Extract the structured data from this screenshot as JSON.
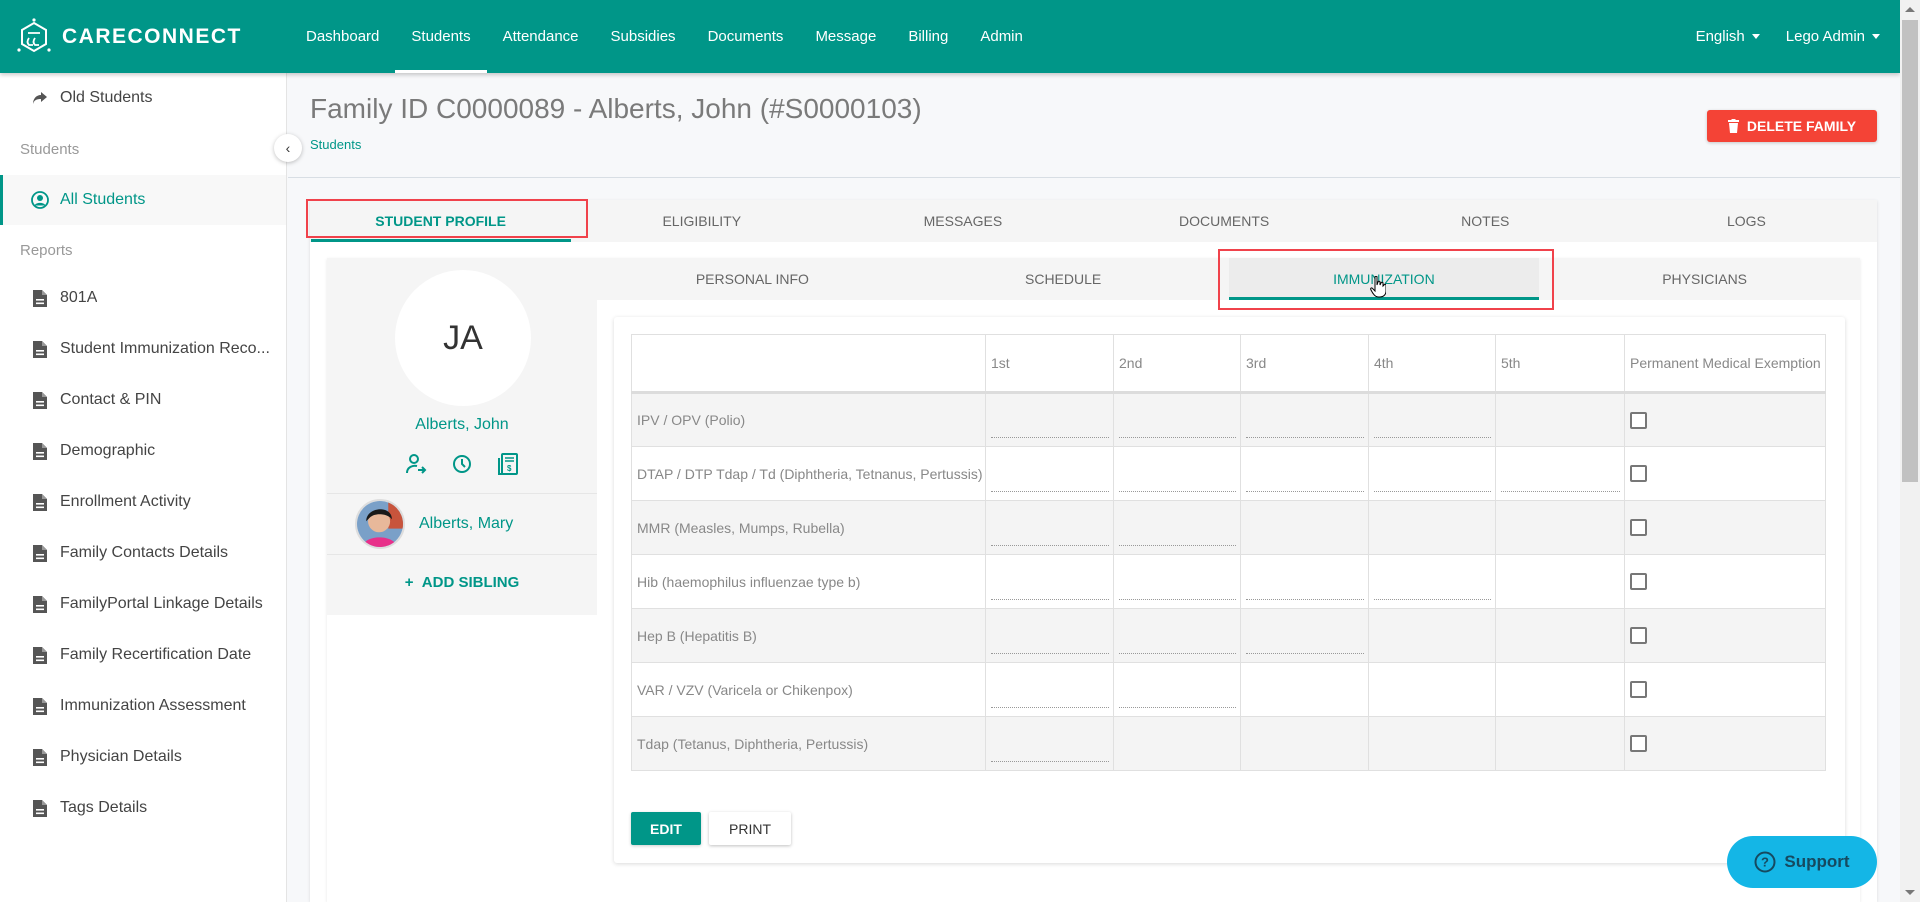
{
  "app": {
    "brand": "CARECONNECT",
    "nav": [
      "Dashboard",
      "Students",
      "Attendance",
      "Subsidies",
      "Documents",
      "Message",
      "Billing",
      "Admin"
    ],
    "nav_active": "Students",
    "language": "English",
    "user": "Lego Admin"
  },
  "sidebar": {
    "top_item": {
      "label": "Old Students",
      "icon": "share-arrow-icon"
    },
    "section_students": "Students",
    "active_item": {
      "label": "All Students",
      "icon": "user-circle-icon"
    },
    "section_reports": "Reports",
    "reports": [
      "801A",
      "Student Immunization Reco...",
      "Contact & PIN",
      "Demographic",
      "Enrollment Activity",
      "Family Contacts Details",
      "FamilyPortal Linkage Details",
      "Family Recertification Date",
      "Immunization Assessment",
      "Physician Details",
      "Tags Details"
    ]
  },
  "page": {
    "title": "Family ID C0000089 - Alberts, John (#S0000103)",
    "breadcrumb": "Students",
    "delete_button": "DELETE FAMILY"
  },
  "main_tabs": [
    "STUDENT PROFILE",
    "ELIGIBILITY",
    "MESSAGES",
    "DOCUMENTS",
    "NOTES",
    "LOGS"
  ],
  "main_tab_active": "STUDENT PROFILE",
  "profile": {
    "initials": "JA",
    "name": "Alberts, John",
    "action_icons": [
      "transfer-user-icon",
      "clock-icon",
      "billing-statement-icon"
    ],
    "sibling": {
      "name": "Alberts, Mary"
    },
    "add_sibling": "ADD SIBLING"
  },
  "sub_tabs": [
    "PERSONAL INFO",
    "SCHEDULE",
    "IMMUNIZATION",
    "PHYSICIANS"
  ],
  "sub_tab_active": "IMMUNIZATION",
  "immunization": {
    "headers": [
      "",
      "1st",
      "2nd",
      "3rd",
      "4th",
      "5th",
      "Permanent Medical Exemption"
    ],
    "rows": [
      {
        "vaccine": "IPV / OPV (Polio)",
        "doses": [
          true,
          true,
          true,
          true,
          false
        ],
        "exempt": false
      },
      {
        "vaccine": "DTAP / DTP Tdap / Td (Diphtheria, Tetnanus, Pertussis)",
        "doses": [
          true,
          true,
          true,
          true,
          true
        ],
        "exempt": false
      },
      {
        "vaccine": "MMR (Measles, Mumps, Rubella)",
        "doses": [
          true,
          true,
          false,
          false,
          false
        ],
        "exempt": false
      },
      {
        "vaccine": "Hib (haemophilus influenzae type b)",
        "doses": [
          true,
          true,
          true,
          true,
          false
        ],
        "exempt": false
      },
      {
        "vaccine": "Hep B (Hepatitis B)",
        "doses": [
          true,
          true,
          true,
          false,
          false
        ],
        "exempt": false
      },
      {
        "vaccine": "VAR / VZV (Varicela or Chikenpox)",
        "doses": [
          true,
          true,
          false,
          false,
          false
        ],
        "exempt": false
      },
      {
        "vaccine": "Tdap (Tetanus, Diphtheria, Pertussis)",
        "doses": [
          true,
          false,
          false,
          false,
          false
        ],
        "exempt": false
      }
    ],
    "edit_button": "EDIT",
    "print_button": "PRINT"
  },
  "support": {
    "label": "Support"
  },
  "colors": {
    "brand": "#009688",
    "danger": "#f44336",
    "support": "#14b6e6",
    "highlight": "#f0424b"
  }
}
